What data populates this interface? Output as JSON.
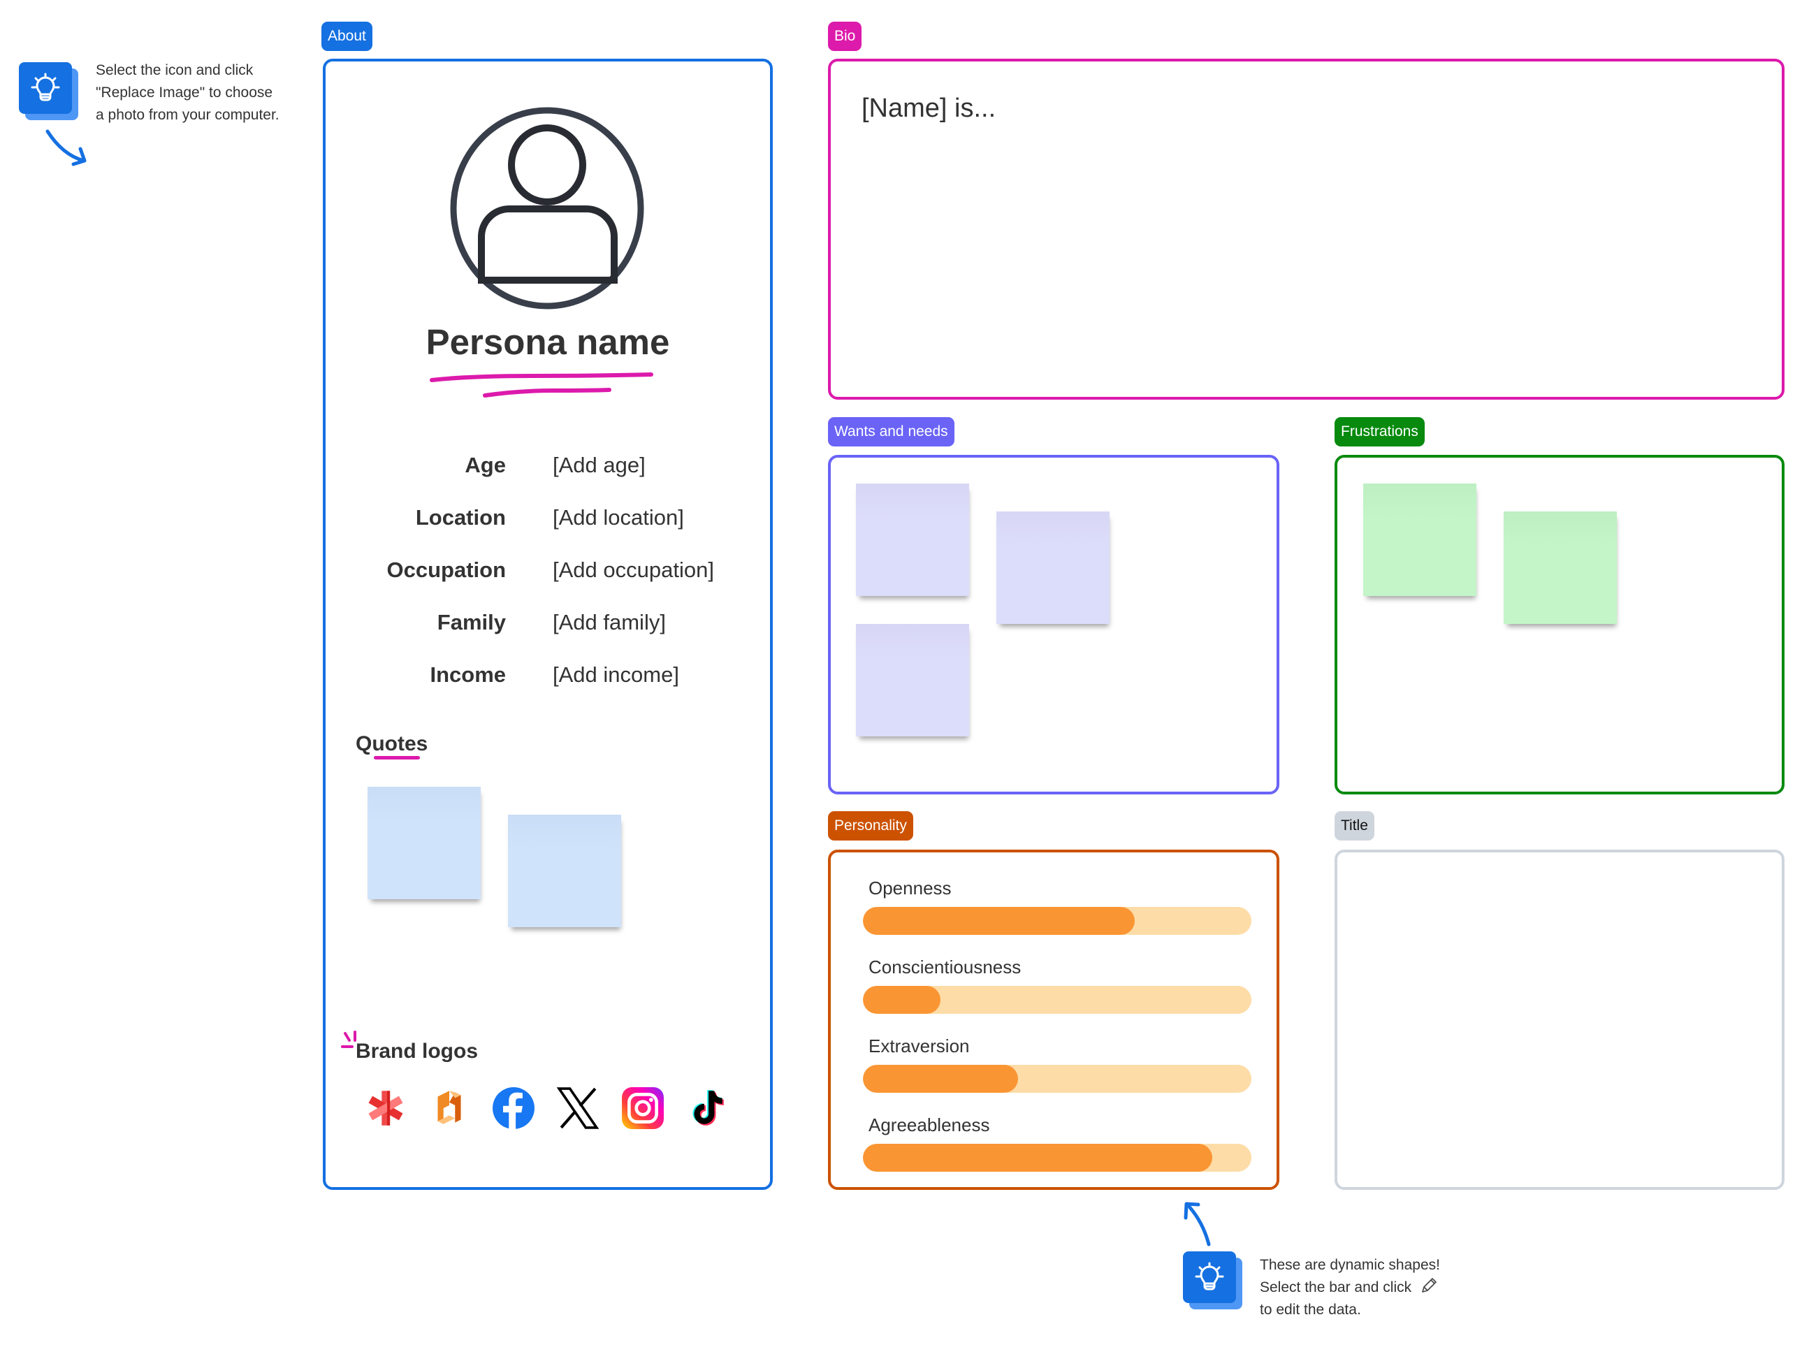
{
  "tips": [
    {
      "text_lines": [
        "Select the icon and click",
        "\"Replace Image\" to choose",
        "a photo from your computer."
      ],
      "icon": "lightbulb-icon"
    },
    {
      "text_lines": [
        "These are dynamic shapes!",
        "Select the bar and click",
        "to edit the data."
      ],
      "icon": "lightbulb-icon",
      "inline_icon": "pencil-icon"
    }
  ],
  "about": {
    "label": "About",
    "avatar_icon": "user-avatar-icon",
    "persona_name": "Persona name",
    "fields": [
      {
        "label": "Age",
        "value": "[Add age]"
      },
      {
        "label": "Location",
        "value": "[Add location]"
      },
      {
        "label": "Occupation",
        "value": "[Add occupation]"
      },
      {
        "label": "Family",
        "value": "[Add family]"
      },
      {
        "label": "Income",
        "value": "[Add income]"
      }
    ],
    "quotes_heading": "Quotes",
    "quotes_notes": 2,
    "brand_logos_heading": "Brand logos",
    "brand_logos": [
      "red-asterisk-logo",
      "orange-hexagon-logo",
      "facebook-logo",
      "x-logo",
      "instagram-logo",
      "tiktok-logo"
    ]
  },
  "bio": {
    "label": "Bio",
    "text": "[Name] is..."
  },
  "wants": {
    "label": "Wants and needs",
    "notes": 3
  },
  "frustrations": {
    "label": "Frustrations",
    "notes": 2
  },
  "personality": {
    "label": "Personality",
    "traits": [
      {
        "name": "Openness",
        "value": 0.7
      },
      {
        "name": "Conscientiousness",
        "value": 0.2
      },
      {
        "name": "Extraversion",
        "value": 0.4
      },
      {
        "name": "Agreeableness",
        "value": 0.9
      }
    ]
  },
  "title_section": {
    "label": "Title"
  },
  "colors": {
    "about": "#1570e1",
    "bio": "#dc1aab",
    "wants": "#6a63f6",
    "frustrations": "#078a0e",
    "personality": "#cc5200",
    "title": "#cfd5dd",
    "bar_fill": "#fa9533",
    "bar_track": "#fddca7",
    "highlight": "#dc1aab"
  }
}
